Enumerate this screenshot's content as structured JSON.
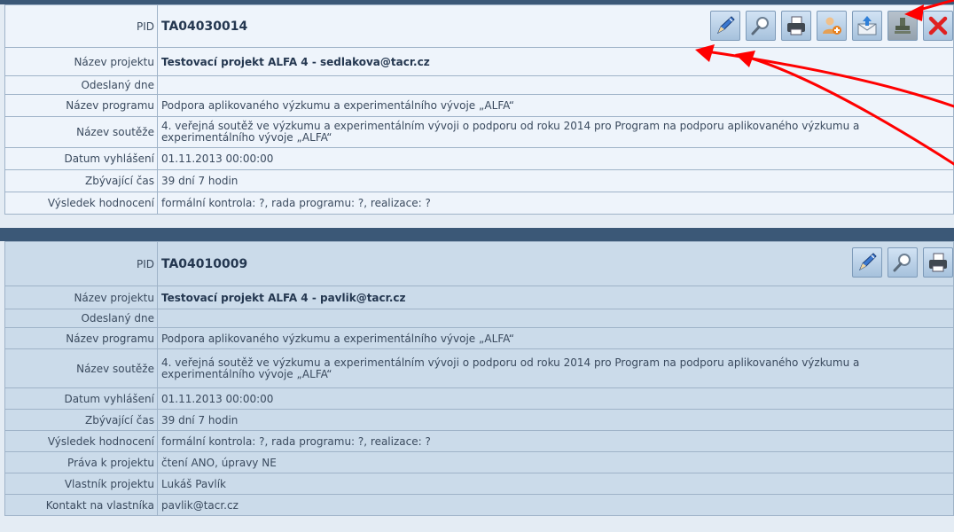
{
  "records": [
    {
      "pid_label": "PID",
      "pid": "TA04030014",
      "rows": [
        {
          "label": "Název projektu",
          "value": "Testovací projekt ALFA 4 - sedlakova@tacr.cz"
        },
        {
          "label": "Odeslaný dne",
          "value": ""
        },
        {
          "label": "Název programu",
          "value": "Podpora aplikovaného výzkumu a experimentálního vývoje „ALFA“"
        },
        {
          "label": "Název soutěže",
          "value": "4. veřejná soutěž ve výzkumu a experimentálním vývoji o podporu od roku 2014 pro Program na podporu aplikovaného výzkumu a experimentálního vývoje „ALFA“"
        },
        {
          "label": "Datum vyhlášení",
          "value": "01.11.2013 00:00:00"
        },
        {
          "label": "Zbývající čas",
          "value": "39 dní 7 hodin"
        },
        {
          "label": "Výsledek hodnocení",
          "value": "formální kontrola: ?, rada programu: ?, realizace: ?"
        }
      ],
      "actions": [
        "pencil-icon",
        "magnifier-icon",
        "printer-icon",
        "add-user-icon",
        "send-mail-icon",
        "stamp-icon",
        "delete-icon"
      ]
    },
    {
      "pid_label": "PID",
      "pid": "TA04010009",
      "rows": [
        {
          "label": "Název projektu",
          "value": "Testovací projekt ALFA 4 - pavlik@tacr.cz"
        },
        {
          "label": "Odeslaný dne",
          "value": ""
        },
        {
          "label": "Název programu",
          "value": "Podpora aplikovaného výzkumu a experimentálního vývoje „ALFA“"
        },
        {
          "label": "Název soutěže",
          "value": "4. veřejná soutěž ve výzkumu a experimentálním vývoji o podporu od roku 2014 pro Program na podporu aplikovaného výzkumu a experimentálního vývoje „ALFA“"
        },
        {
          "label": "Datum vyhlášení",
          "value": "01.11.2013 00:00:00"
        },
        {
          "label": "Zbývající čas",
          "value": "39 dní 7 hodin"
        },
        {
          "label": "Výsledek hodnocení",
          "value": "formální kontrola: ?, rada programu: ?, realizace: ?"
        },
        {
          "label": "Práva k projektu",
          "value": "čtení ANO, úpravy NE"
        },
        {
          "label": "Vlastník projektu",
          "value": "Lukáš Pavlík"
        },
        {
          "label": "Kontakt na vlastníka",
          "value": "pavlik@tacr.cz"
        }
      ],
      "actions": [
        "pencil-icon",
        "magnifier-icon",
        "printer-icon"
      ]
    }
  ],
  "colors": {
    "header_bar": "#3b5877",
    "record1_bg": "#eef4fb",
    "record2_bg": "#cbdbea",
    "annotation_arrow": "#ff0000"
  }
}
